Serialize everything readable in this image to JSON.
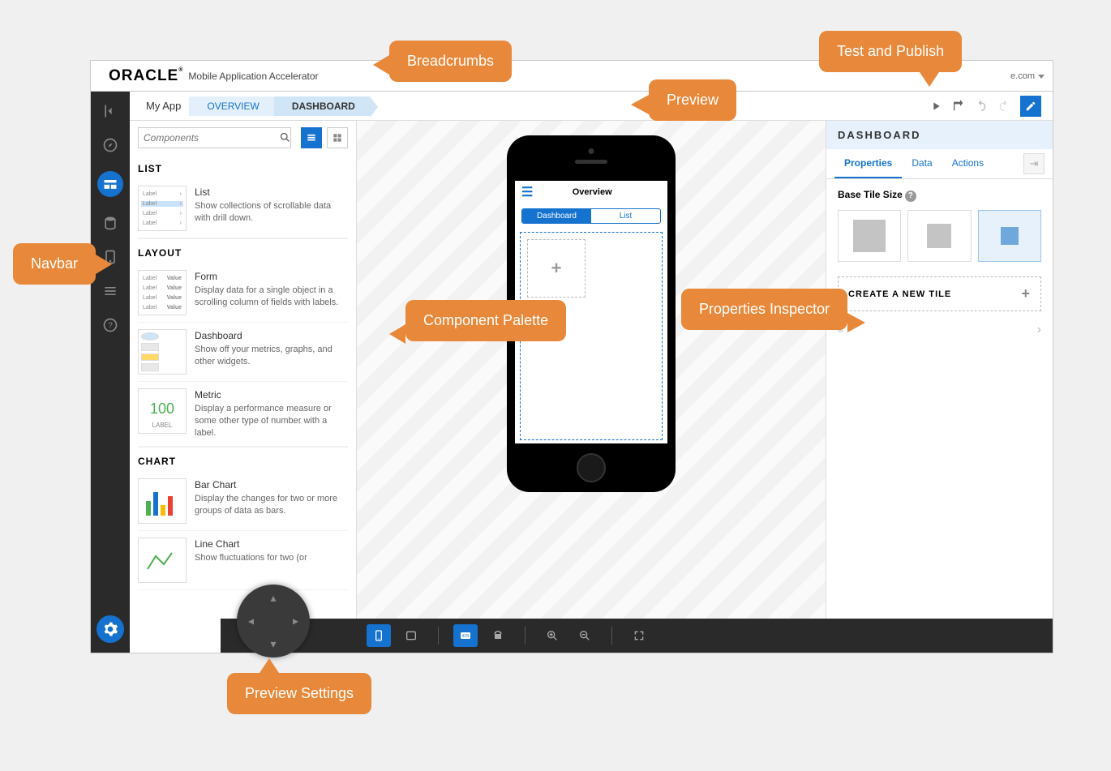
{
  "header": {
    "logo": "ORACLE",
    "subtitle": "Mobile Application Accelerator",
    "user": "e.com"
  },
  "crumbs": {
    "app": "My App",
    "c1": "OVERVIEW",
    "c2": "DASHBOARD"
  },
  "palette": {
    "search_placeholder": "Components",
    "sect_list": "LIST",
    "sect_layout": "LAYOUT",
    "sect_chart": "CHART",
    "items": {
      "list": {
        "name": "List",
        "desc": "Show collections of scrollable data with drill down."
      },
      "form": {
        "name": "Form",
        "desc": "Display data for a single object in a scrolling column of fields with labels."
      },
      "dashboard": {
        "name": "Dashboard",
        "desc": "Show off your metrics, graphs, and other widgets."
      },
      "metric": {
        "name": "Metric",
        "desc": "Display a performance measure or some other type of number with a label.",
        "value": "100",
        "label": "LABEL"
      },
      "bar": {
        "name": "Bar Chart",
        "desc": "Display the changes for two or more groups of data as bars."
      },
      "line": {
        "name": "Line Chart",
        "desc": "Show fluctuations for two (or"
      }
    },
    "thumb_label": "Label",
    "thumb_value": "Value"
  },
  "phone": {
    "title": "Overview",
    "seg_on": "Dashboard",
    "seg_off": "List",
    "add": "+"
  },
  "inspector": {
    "title": "DASHBOARD",
    "tabs": {
      "properties": "Properties",
      "data": "Data",
      "actions": "Actions"
    },
    "base_label": "Base Tile Size",
    "new_tile": "CREATE A NEW TILE"
  },
  "callouts": {
    "navbar": "Navbar",
    "crumbs": "Breadcrumbs",
    "comp": "Component Palette",
    "preview": "Preview",
    "test": "Test and Publish",
    "props": "Properties Inspector",
    "psettings": "Preview Settings"
  }
}
